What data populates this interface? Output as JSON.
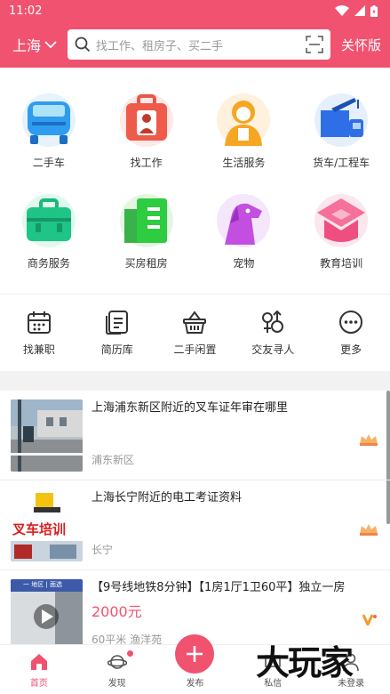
{
  "status_bar": {
    "time": "11:02"
  },
  "header": {
    "city": "上海",
    "search_placeholder": "找工作、租房子、买二手",
    "care_mode": "关怀版"
  },
  "categories_big": [
    {
      "label": "二手车",
      "icon": "jeep-icon"
    },
    {
      "label": "找工作",
      "icon": "briefcase-person-icon"
    },
    {
      "label": "生活服务",
      "icon": "service-person-icon"
    },
    {
      "label": "货车/工程车",
      "icon": "truck-crane-icon"
    },
    {
      "label": "商务服务",
      "icon": "business-bag-icon"
    },
    {
      "label": "买房租房",
      "icon": "building-icon"
    },
    {
      "label": "宠物",
      "icon": "dog-icon"
    },
    {
      "label": "教育培训",
      "icon": "graduation-cap-icon"
    }
  ],
  "categories_small": [
    {
      "label": "找兼职",
      "icon": "calendar-icon"
    },
    {
      "label": "简历库",
      "icon": "resume-icon"
    },
    {
      "label": "二手闲置",
      "icon": "basket-icon"
    },
    {
      "label": "交友寻人",
      "icon": "gender-icon"
    },
    {
      "label": "更多",
      "icon": "more-icon"
    }
  ],
  "listings": [
    {
      "title": "上海浦东新区附近的叉车证年审在哪里",
      "price": "",
      "meta": "浦东新区",
      "badge": "crown-badge"
    },
    {
      "title": "上海长宁附近的电工考证资料",
      "price": "",
      "meta": "长宁",
      "badge": "crown-badge",
      "thumb_text": "叉车培训"
    },
    {
      "title": "【9号线地铁8分钟】【1房1厅1卫60平】独立一房",
      "price": "2000元",
      "meta": "60平米 渔洋苑",
      "badge": "v-badge",
      "thumb_text": "一 地区 | 面选"
    }
  ],
  "tabbar": [
    {
      "label": "首页",
      "icon": "home-icon"
    },
    {
      "label": "发现",
      "icon": "planet-icon"
    },
    {
      "label": "发布",
      "icon": "plus-icon"
    },
    {
      "label": "私信",
      "icon": "message-icon"
    },
    {
      "label": "未登录",
      "icon": "user-icon"
    }
  ],
  "watermark": "大玩家",
  "colors": {
    "brand": "#f0526f"
  }
}
